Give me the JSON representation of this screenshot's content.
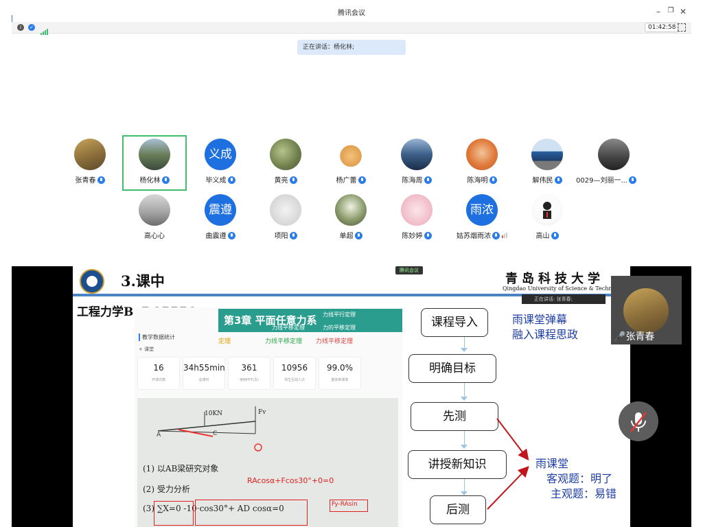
{
  "window": {
    "title": "腾讯会议"
  },
  "toolbar": {
    "timer": "01:42:58"
  },
  "speaking_banner": "正在讲话：杨化林;",
  "participants": [
    {
      "name": "张青春"
    },
    {
      "name": "杨化林"
    },
    {
      "name": "毕义成",
      "avatar_text": "义成"
    },
    {
      "name": "黄亮"
    },
    {
      "name": "杨广蕾"
    },
    {
      "name": "陈海周"
    },
    {
      "name": "陈海明"
    },
    {
      "name": "解伟民"
    },
    {
      "name": "0029—刘丽一..."
    },
    {
      "name": "高心心"
    },
    {
      "name": "曲震遵",
      "avatar_text": "震遵"
    },
    {
      "name": "项阳"
    },
    {
      "name": "单超"
    },
    {
      "name": "陈妙婷"
    },
    {
      "name": "姑苏烟雨浓",
      "avatar_text": "雨浓"
    },
    {
      "name": "高山"
    }
  ],
  "share": {
    "ppt_label": "腾讯会议",
    "slide_title": "3.课中",
    "university_cn": "青岛科技大学",
    "university_en": "Qingdao University of Science & Technology",
    "subtitle": "工程力学B:  BOPPPS",
    "banner_title": "第3章  平面任意力系",
    "banner_sub1": "力线平行定理",
    "banner_sub2": "力线平移定理",
    "banner_sub3": "力的平移定理",
    "law1": "定理",
    "law2": "力线平移定理",
    "law3": "力线平移定理",
    "stats_header": "教学数据统计",
    "stats_sub": "+ 课堂",
    "stats": [
      {
        "value": "16",
        "label": "开课次数"
      },
      {
        "value": "34h55min",
        "label": "总课时"
      },
      {
        "value": "361",
        "label": "使用PPT(页)"
      },
      {
        "value": "10956",
        "label": "师生互动人次"
      },
      {
        "value": "99.0%",
        "label": "整体到课率"
      }
    ],
    "hw_line1": "(1) 以AB梁研究对象",
    "hw_line2": "(2) 受力分析",
    "hw_line3": "(3) ∑X=0   -10·cos30°+ AD cosα=0",
    "red_eq": "RAcosα+Fcos30°+0=0",
    "red_eq2": "Fy-RAsin",
    "label_10kn": "10KN",
    "label_fv": "Fv",
    "flow": [
      "课程导入",
      "明确目标",
      "先测",
      "讲授新知识",
      "后测"
    ],
    "note_top": "雨课堂弹幕\n融入课程思政",
    "note_top_1": "雨课堂弹幕",
    "note_top_2": "融入课程思政",
    "note_bottom_1": "雨课堂",
    "note_bottom_2": "客观题：明了",
    "note_bottom_3": "主观题：易错"
  },
  "right_panel": {
    "speaking_tag": "正在讲话: 张青春;",
    "name": "张青春"
  },
  "colors": {
    "accent": "#1e6fe0",
    "highlight": "#3fbf6d",
    "arrow": "#c0161c"
  }
}
